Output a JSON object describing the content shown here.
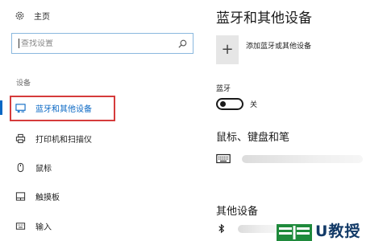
{
  "nav": {
    "home_label": "主页",
    "search_placeholder": "查找设置",
    "section_label": "设备",
    "items": [
      {
        "label": "蓝牙和其他设备",
        "icon": "bluetooth-devices-icon",
        "active": true
      },
      {
        "label": "打印机和扫描仪",
        "icon": "printer-icon",
        "active": false
      },
      {
        "label": "鼠标",
        "icon": "mouse-icon",
        "active": false
      },
      {
        "label": "触摸板",
        "icon": "touchpad-icon",
        "active": false
      },
      {
        "label": "输入",
        "icon": "keyboard-icon",
        "active": false
      }
    ]
  },
  "content": {
    "title": "蓝牙和其他设备",
    "add_device_label": "添加蓝牙或其他设备",
    "bluetooth_label": "蓝牙",
    "bluetooth_state": "关",
    "mouse_section_title": "鼠标、键盘和笔",
    "other_section_title": "其他设备"
  },
  "watermark": {
    "text": "U教授"
  },
  "colors": {
    "accent": "#0a68c4",
    "highlight_box": "#d53b3b",
    "watermark_green": "#1f8a3c"
  }
}
